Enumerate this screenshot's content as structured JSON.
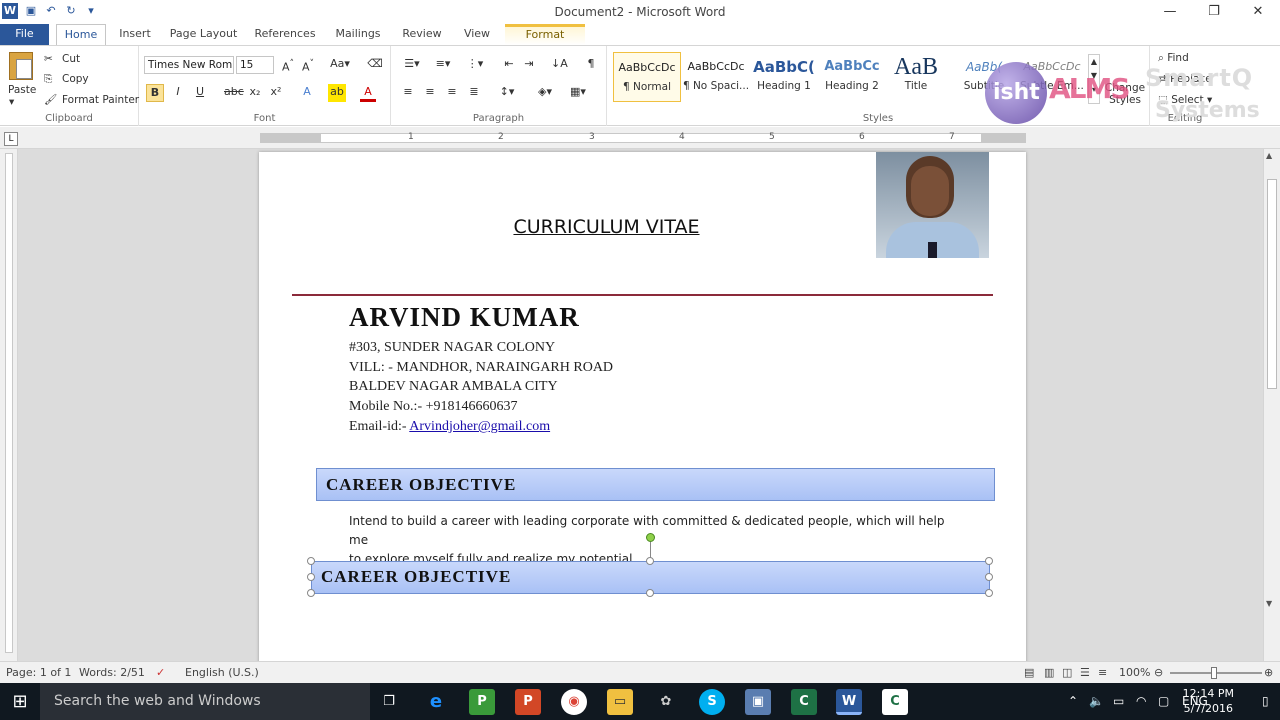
{
  "window": {
    "title": "Document2 - Microsoft Word",
    "controls": [
      "—",
      "❐",
      "✕"
    ]
  },
  "tabs": [
    "File",
    "Home",
    "Insert",
    "Page Layout",
    "References",
    "Mailings",
    "Review",
    "View",
    "Format"
  ],
  "ribbon": {
    "clipboard": {
      "paste": "Paste",
      "cut": "Cut",
      "copy": "Copy",
      "format_painter": "Format Painter",
      "label": "Clipboard"
    },
    "font": {
      "font_name": "Times New Rom",
      "font_size": "15",
      "label": "Font"
    },
    "paragraph": {
      "label": "Paragraph"
    },
    "styles": {
      "label": "Styles",
      "items": [
        {
          "sample": "AaBbCcDc",
          "name": "¶ Normal"
        },
        {
          "sample": "AaBbCcDc",
          "name": "¶ No Spaci..."
        },
        {
          "sample": "AaBbC(",
          "name": "Heading 1"
        },
        {
          "sample": "AaBbCc",
          "name": "Heading 2"
        },
        {
          "sample": "AaB",
          "name": "Title"
        },
        {
          "sample": "AaBb(",
          "name": "Subtitle"
        },
        {
          "sample": "AaBbCcDc",
          "name": "Subtle Em..."
        }
      ],
      "change_styles": "Change Styles"
    },
    "editing": {
      "find": "Find",
      "replace": "Replace",
      "select": "Select",
      "label": "Editing"
    }
  },
  "watermark": {
    "brand_left": "isht",
    "brand_right": "SmartQ",
    "brand_sub": "Systems"
  },
  "ruler_numbers": [
    "1",
    "2",
    "3",
    "4",
    "5",
    "6",
    "7"
  ],
  "document": {
    "title": "CURRICULUM VITAE",
    "name": "ARVIND KUMAR",
    "address_lines": [
      "#303, SUNDER NAGAR COLONY",
      "VILL: - MANDHOR, NARAINGARH ROAD",
      "BALDEV NAGAR AMBALA CITY",
      "Mobile No.:- +918146660637"
    ],
    "email_label": "Email-id:-",
    "email": "Arvindjoher@gmail.com",
    "section1": "CAREER OBJECTIVE",
    "objective_line1": "Intend to build a career with leading corporate with committed & dedicated people, which will help me",
    "objective_line2": "to explore myself fully and realize my potential.",
    "section2": "CAREER OBJECTIVE"
  },
  "status": {
    "page": "Page: 1 of 1",
    "words": "Words: 2/51",
    "language": "English (U.S.)",
    "zoom": "100%"
  },
  "taskbar": {
    "search_placeholder": "Search the web and Windows",
    "lang": "ENG",
    "time": "12:14 PM",
    "date": "5/7/2016"
  },
  "colors": {
    "accent": "#2b579a",
    "section_bar": "#b4c9f7",
    "rule": "#8b2a3a",
    "link": "#1a0dab"
  }
}
